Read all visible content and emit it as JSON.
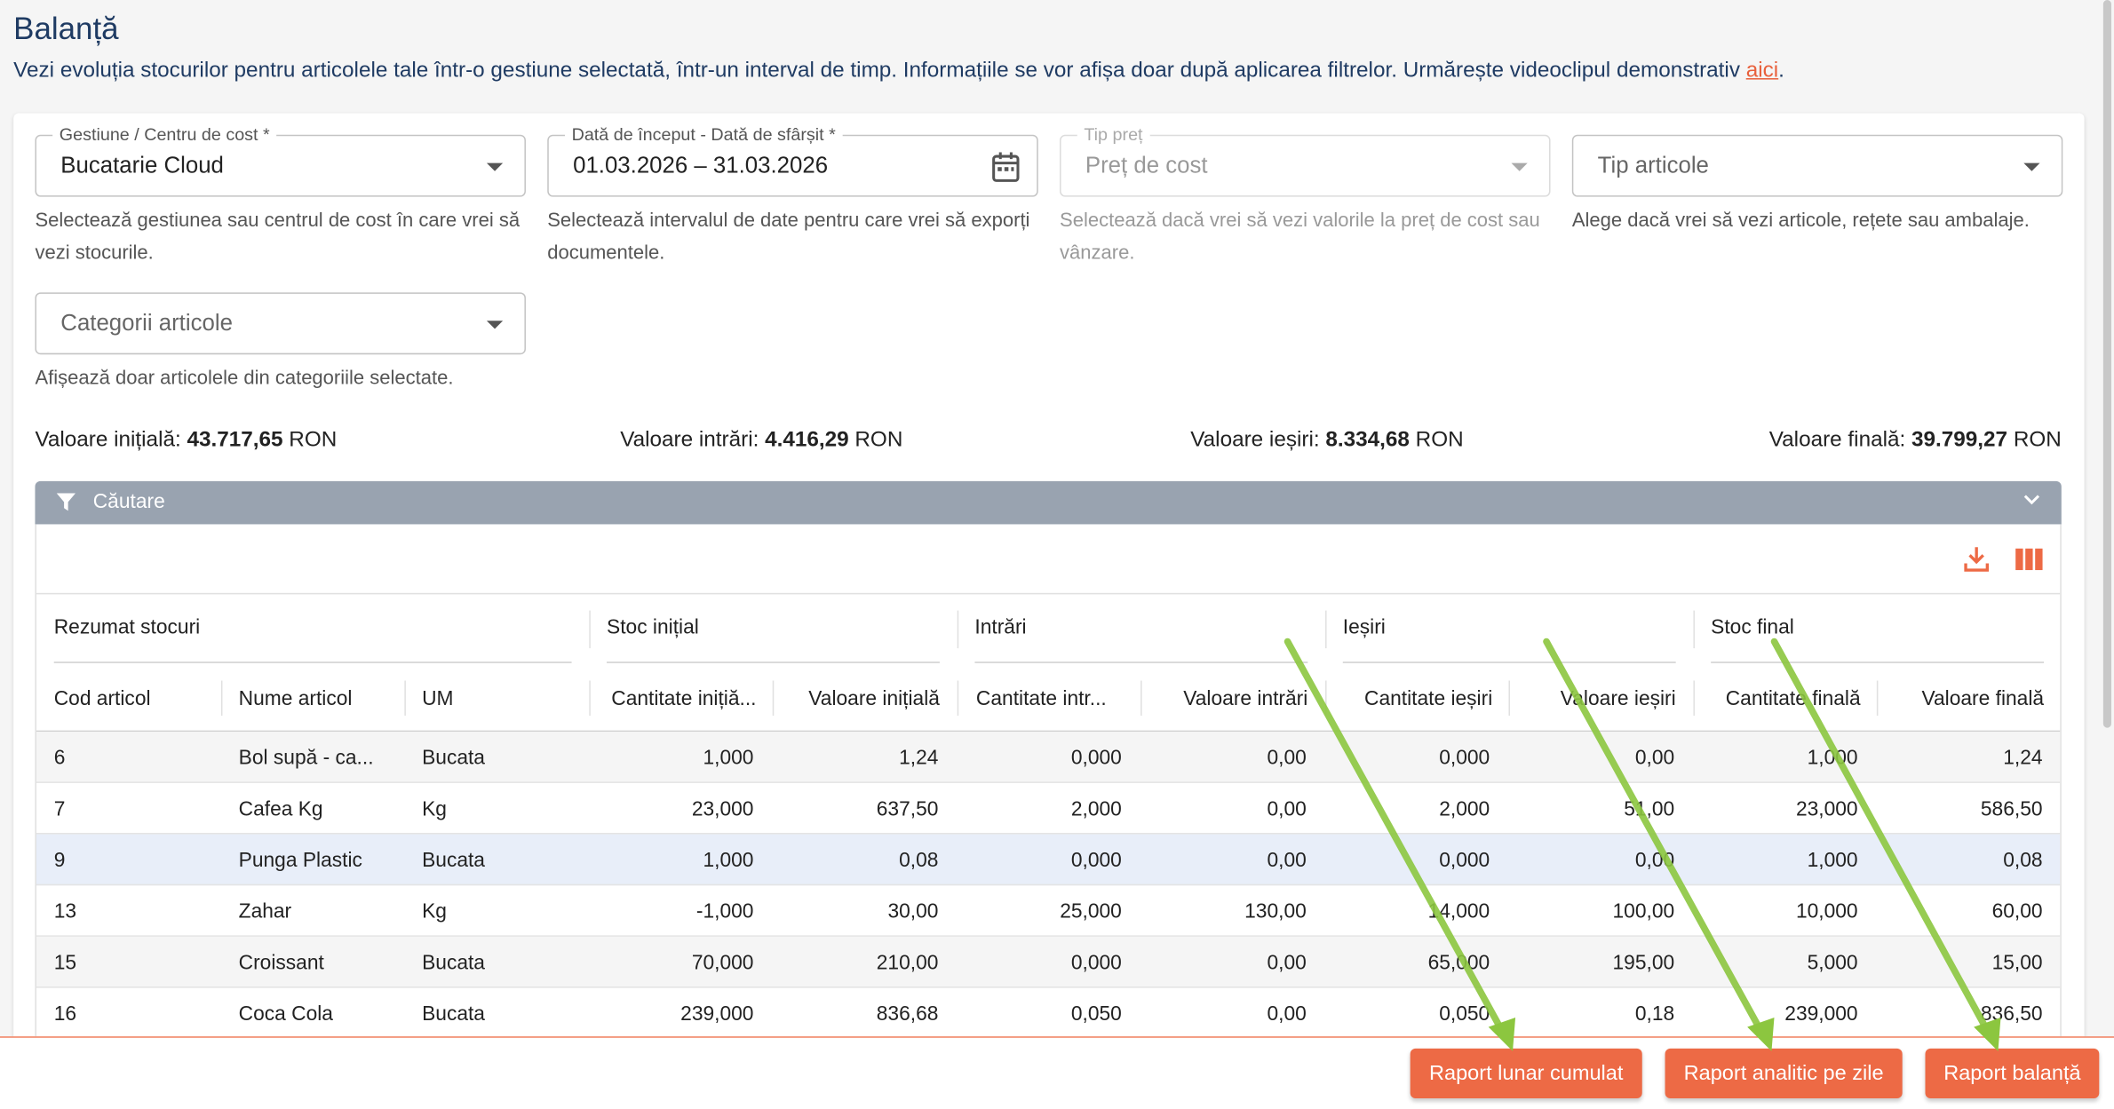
{
  "page": {
    "title": "Balanță",
    "description": "Vezi evoluția stocurilor pentru articolele tale într-o gestiune selectată, într-un interval de timp. Informațiile se vor afișa doar după aplicarea filtrelor. Urmărește videoclipul demonstrativ ",
    "link_text": "aici",
    "description_end": "."
  },
  "filters": {
    "gestiune": {
      "label": "Gestiune / Centru de cost *",
      "value": "Bucatarie Cloud",
      "help": "Selectează gestiunea sau centrul de cost în care vrei să vezi stocurile."
    },
    "data": {
      "label": "Dată de început - Dată de sfârșit *",
      "value": "01.03.2026 – 31.03.2026",
      "help": "Selectează intervalul de date pentru care vrei să exporți documentele."
    },
    "tip_pret": {
      "label": "Tip preț",
      "value": "Preț de cost",
      "help": "Selectează dacă vrei să vezi valorile la preț de cost sau vânzare."
    },
    "tip_articole": {
      "value": "Tip articole",
      "help": "Alege dacă vrei să vezi articole, rețete sau ambalaje."
    },
    "categorii": {
      "value": "Categorii articole",
      "help": "Afișează doar articolele din categoriile selectate."
    }
  },
  "totals": {
    "initial_label": "Valoare inițială:",
    "initial_value": "43.717,65",
    "intrari_label": "Valoare intrări:",
    "intrari_value": "4.416,29",
    "iesiri_label": "Valoare ieșiri:",
    "iesiri_value": "8.334,68",
    "final_label": "Valoare finală:",
    "final_value": "39.799,27",
    "currency": "RON"
  },
  "search": {
    "label": "Căutare"
  },
  "table": {
    "groups": [
      "Rezumat stocuri",
      "Stoc inițial",
      "Intrări",
      "Ieșiri",
      "Stoc final"
    ],
    "columns": [
      "Cod articol",
      "Nume articol",
      "UM",
      "Cantitate inițiă...",
      "Valoare inițială",
      "Cantitate intr...",
      "Valoare intrări",
      "Cantitate ieșiri",
      "Valoare ieșiri",
      "Cantitate finală",
      "Valoare finală"
    ],
    "rows": [
      [
        "6",
        "Bol supă - ca...",
        "Bucata",
        "1,000",
        "1,24",
        "0,000",
        "0,00",
        "0,000",
        "0,00",
        "1,000",
        "1,24"
      ],
      [
        "7",
        "Cafea Kg",
        "Kg",
        "23,000",
        "637,50",
        "2,000",
        "0,00",
        "2,000",
        "51,00",
        "23,000",
        "586,50"
      ],
      [
        "9",
        "Punga Plastic",
        "Bucata",
        "1,000",
        "0,08",
        "0,000",
        "0,00",
        "0,000",
        "0,00",
        "1,000",
        "0,08"
      ],
      [
        "13",
        "Zahar",
        "Kg",
        "-1,000",
        "30,00",
        "25,000",
        "130,00",
        "14,000",
        "100,00",
        "10,000",
        "60,00"
      ],
      [
        "15",
        "Croissant",
        "Bucata",
        "70,000",
        "210,00",
        "0,000",
        "0,00",
        "65,000",
        "195,00",
        "5,000",
        "15,00"
      ],
      [
        "16",
        "Coca Cola",
        "Bucata",
        "239,000",
        "836,68",
        "0,050",
        "0,00",
        "0,050",
        "0,18",
        "239,000",
        "836,50"
      ]
    ]
  },
  "buttons": {
    "raport_lunar": "Raport lunar cumulat",
    "raport_analitic": "Raport analitic pe zile",
    "raport_balanta": "Raport balanță"
  },
  "colors": {
    "accent": "#ed6a45",
    "title": "#1f3b63",
    "search_bar": "#99a3b0",
    "selected_row": "#e8eef9",
    "annotation_arrow": "#8cc63f"
  }
}
